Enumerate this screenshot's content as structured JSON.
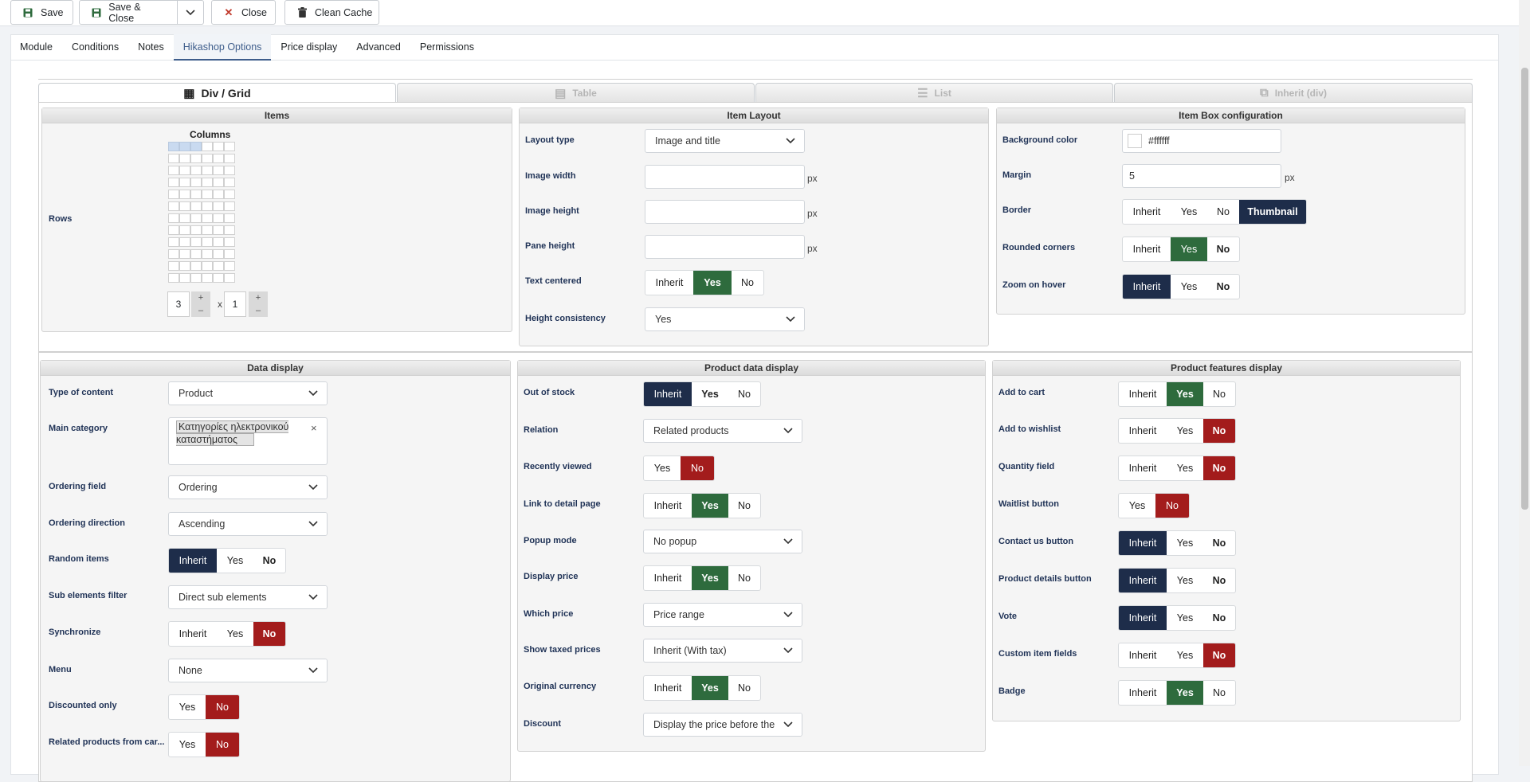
{
  "toolbar": {
    "save": "Save",
    "save_close": "Save & Close",
    "close": "Close",
    "clean_cache": "Clean Cache"
  },
  "tabs": [
    "Module",
    "Conditions",
    "Notes",
    "Hikashop Options",
    "Price display",
    "Advanced",
    "Permissions"
  ],
  "active_tab": "Hikashop Options",
  "view_tabs": [
    "Div / Grid",
    "Table",
    "List",
    "Inherit (div)"
  ],
  "items_panel": {
    "title": "Items",
    "columns_label": "Columns",
    "rows_label": "Rows",
    "columns_value": "3",
    "x": "x",
    "rows_value": "1",
    "plus": "+",
    "minus": "–"
  },
  "item_layout": {
    "title": "Item Layout",
    "layout_type_label": "Layout type",
    "layout_type": "Image and title",
    "image_width_label": "Image width",
    "image_height_label": "Image height",
    "pane_height_label": "Pane height",
    "px": "px",
    "text_centered_label": "Text centered",
    "height_consistency_label": "Height consistency",
    "height_consistency": "Yes"
  },
  "item_box": {
    "title": "Item Box configuration",
    "background_label": "Background color",
    "background": "#ffffff",
    "margin_label": "Margin",
    "margin": "5",
    "border_label": "Border",
    "rounded_label": "Rounded corners",
    "zoom_label": "Zoom on hover"
  },
  "data_display": {
    "title": "Data display",
    "type_label": "Type of content",
    "type": "Product",
    "main_category_label": "Main category",
    "main_category": "Κατηγορίες ηλεκτρονικού καταστήματος",
    "chip_remove": "×",
    "ordering_field_label": "Ordering field",
    "ordering_field": "Ordering",
    "ordering_direction_label": "Ordering direction",
    "ordering_direction": "Ascending",
    "random_label": "Random items",
    "sub_filter_label": "Sub elements filter",
    "sub_filter": "Direct sub elements",
    "sync_label": "Synchronize",
    "menu_label": "Menu",
    "menu": "None",
    "discounted_label": "Discounted only",
    "related_cart_label": "Related products from car..."
  },
  "product_data": {
    "title": "Product data display",
    "out_of_stock_label": "Out of stock",
    "relation_label": "Relation",
    "relation": "Related products",
    "recently_label": "Recently viewed",
    "link_label": "Link to detail page",
    "popup_label": "Popup mode",
    "popup": "No popup",
    "display_price_label": "Display price",
    "which_price_label": "Which price",
    "which_price": "Price range",
    "taxed_label": "Show taxed prices",
    "taxed": "Inherit (With tax)",
    "currency_label": "Original currency",
    "discount_label": "Discount",
    "discount": "Display the price before the"
  },
  "features": {
    "title": "Product features display",
    "add_cart_label": "Add to cart",
    "wishlist_label": "Add to wishlist",
    "quantity_label": "Quantity field",
    "waitlist_label": "Waitlist button",
    "contact_label": "Contact us button",
    "details_label": "Product details button",
    "vote_label": "Vote",
    "custom_label": "Custom item fields",
    "badge_label": "Badge"
  },
  "opt": {
    "inherit": "Inherit",
    "yes": "Yes",
    "no": "No",
    "thumbnail": "Thumbnail"
  },
  "colors": {
    "active_blue": "#1e2d4a",
    "active_green": "#2e6b3d",
    "active_red": "#a31c1c",
    "tab_accent": "#3e5d8b"
  }
}
